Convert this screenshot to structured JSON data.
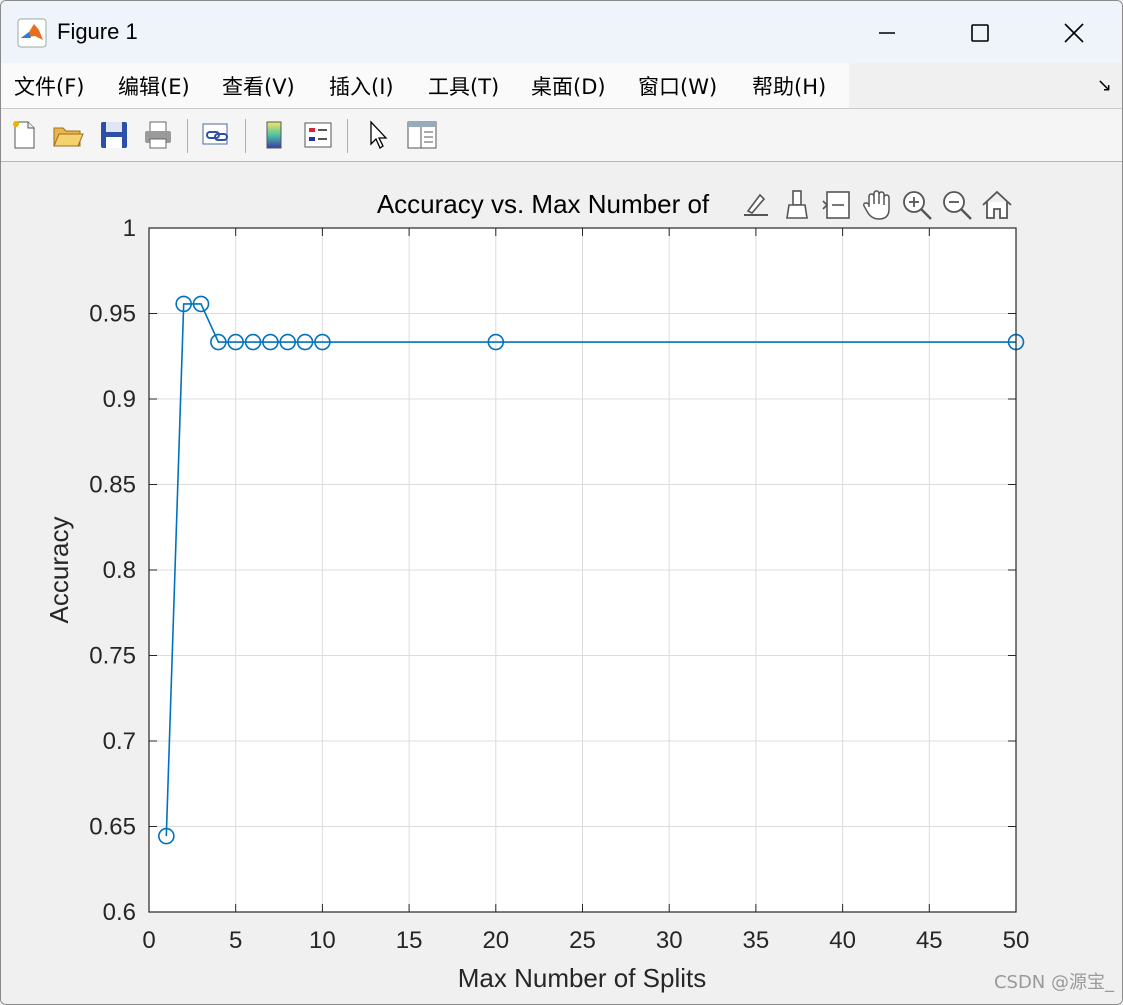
{
  "window": {
    "title": "Figure 1",
    "icon": "matlab-logo-icon"
  },
  "menu": [
    "文件(F)",
    "编辑(E)",
    "查看(V)",
    "插入(I)",
    "工具(T)",
    "桌面(D)",
    "窗口(W)",
    "帮助(H)"
  ],
  "toolbar": {
    "buttons": [
      "new-figure-icon",
      "open-file-icon",
      "save-icon",
      "print-icon",
      "link-plot-icon",
      "colorbar-icon",
      "legend-icon",
      "edit-plot-arrow-icon",
      "property-inspector-icon"
    ]
  },
  "axes_toolbar": {
    "buttons": [
      "data-tips-icon",
      "brush-icon",
      "data-cursor-icon",
      "pan-icon",
      "zoom-in-icon",
      "zoom-out-icon",
      "restore-view-home-icon"
    ]
  },
  "watermark": "CSDN @源宝_",
  "chart_data": {
    "type": "line",
    "title": "Accuracy vs. Max Number of",
    "xlabel": "Max Number of Splits",
    "ylabel": "Accuracy",
    "xlim": [
      0,
      50
    ],
    "ylim": [
      0.6,
      1
    ],
    "xticks": [
      0,
      5,
      10,
      15,
      20,
      25,
      30,
      35,
      40,
      45,
      50
    ],
    "yticks": [
      0.6,
      0.65,
      0.7,
      0.75,
      0.8,
      0.85,
      0.9,
      0.95,
      1
    ],
    "ytick_labels": [
      "0.6",
      "0.65",
      "0.7",
      "0.75",
      "0.8",
      "0.85",
      "0.9",
      "0.95",
      "1"
    ],
    "grid": true,
    "marker": "circle",
    "color": "#0072bd",
    "series": [
      {
        "x": [
          1,
          2,
          3,
          4,
          5,
          6,
          7,
          8,
          9,
          10,
          20,
          50
        ],
        "y": [
          0.6444,
          0.9556,
          0.9556,
          0.9333,
          0.9333,
          0.9333,
          0.9333,
          0.9333,
          0.9333,
          0.9333,
          0.9333,
          0.9333
        ]
      }
    ]
  }
}
